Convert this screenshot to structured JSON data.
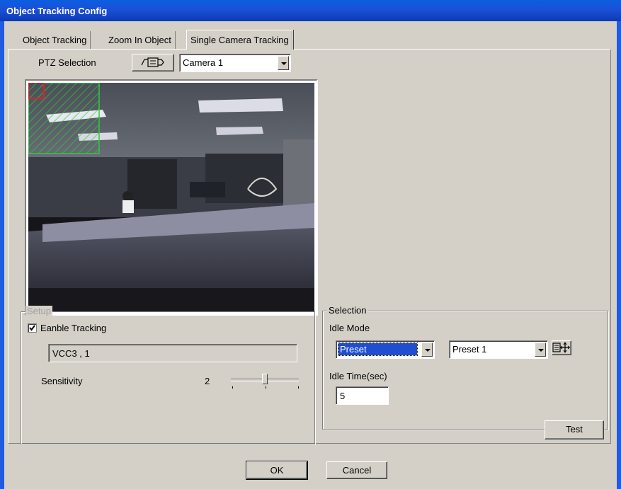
{
  "window": {
    "title": "Object Tracking Config"
  },
  "tabs": [
    {
      "label": "Object Tracking",
      "active": false
    },
    {
      "label": "Zoom In Object",
      "active": false
    },
    {
      "label": "Single Camera Tracking",
      "active": true
    }
  ],
  "ptz": {
    "label": "PTZ Selection",
    "camera_selected": "Camera 1"
  },
  "setup": {
    "title": "Setup",
    "enable_tracking_label": "Eanble Tracking",
    "enable_tracking_checked": true,
    "device_value": "VCC3 , 1",
    "sensitivity_label": "Sensitivity",
    "sensitivity_value": "2"
  },
  "selection": {
    "title": "Selection",
    "idle_mode_label": "Idle Mode",
    "idle_mode_value": "Preset",
    "preset_value": "Preset 1",
    "idle_time_label": "Idle Time(sec)",
    "idle_time_value": "5"
  },
  "buttons": {
    "test": "Test",
    "ok": "OK",
    "cancel": "Cancel"
  },
  "colors": {
    "title_bar": "#1c4fd8",
    "tracking_zone": "#2ecc40",
    "selection_highlight": "#1f4fd0"
  }
}
